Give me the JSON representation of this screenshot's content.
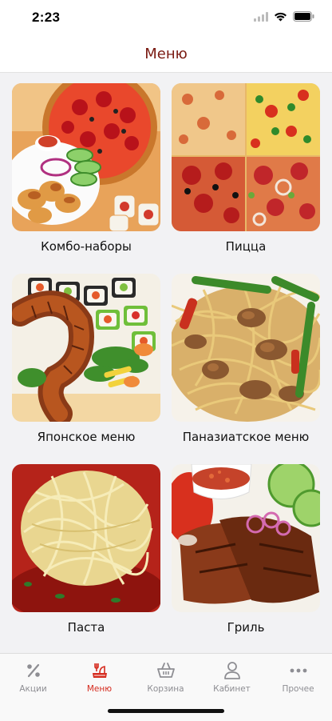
{
  "status_bar": {
    "time": "2:23"
  },
  "header": {
    "title": "Меню"
  },
  "categories": [
    {
      "label": "Комбо-наборы",
      "image": "combo-platter"
    },
    {
      "label": "Пицца",
      "image": "pizza-collage"
    },
    {
      "label": "Японское меню",
      "image": "sushi-rolls"
    },
    {
      "label": "Паназиатское меню",
      "image": "noodles-stir-fry"
    },
    {
      "label": "Паста",
      "image": "pasta-plate"
    },
    {
      "label": "Гриль",
      "image": "grilled-meat"
    }
  ],
  "tabbar": {
    "accent": "#d52b1e",
    "inactive": "#8e8e93",
    "items": [
      {
        "label": "Акции",
        "icon": "percent-icon",
        "active": false
      },
      {
        "label": "Меню",
        "icon": "menu-dish-icon",
        "active": true
      },
      {
        "label": "Корзина",
        "icon": "basket-icon",
        "active": false
      },
      {
        "label": "Кабинет",
        "icon": "profile-icon",
        "active": false
      },
      {
        "label": "Прочее",
        "icon": "more-dots-icon",
        "active": false
      }
    ]
  },
  "colors": {
    "title": "#7a1a12",
    "background": "#f2f2f4"
  }
}
